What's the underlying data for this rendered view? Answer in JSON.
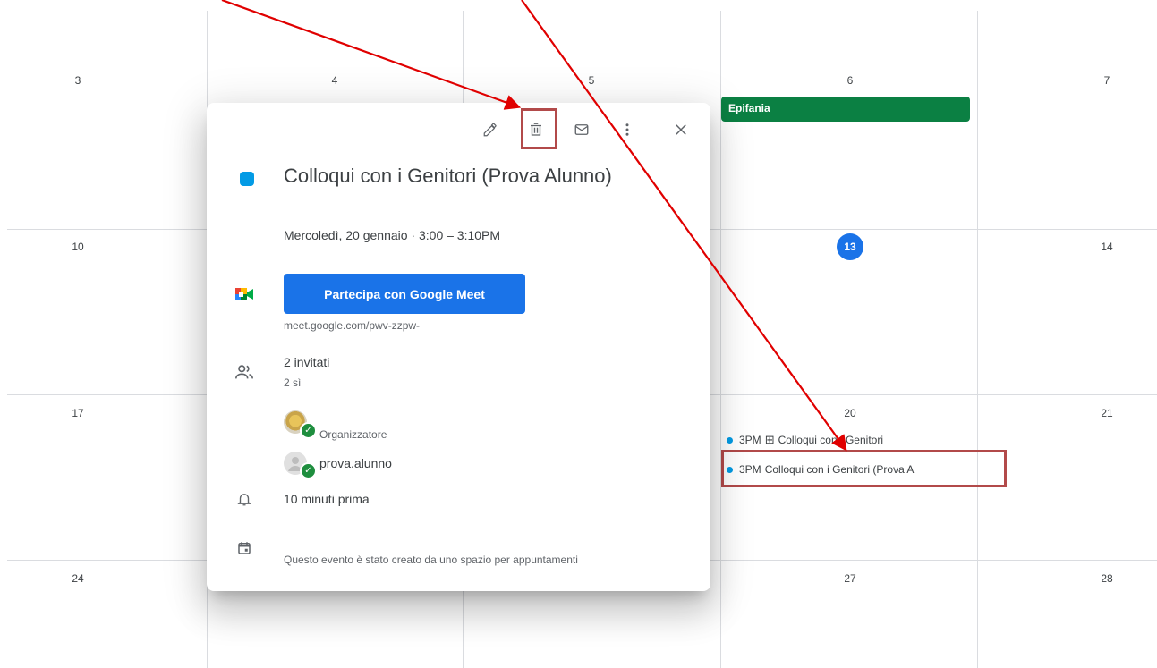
{
  "calendar": {
    "day_numbers": {
      "row1": [
        "3",
        "4",
        "5",
        "6",
        "7"
      ],
      "row2": [
        "10",
        "13",
        "14"
      ],
      "row3": [
        "17",
        "20",
        "21"
      ],
      "row4": [
        "24",
        "27",
        "28"
      ]
    },
    "holiday": "Epifania",
    "events": [
      {
        "time": "3PM",
        "title": "Colloqui con i Genitori"
      },
      {
        "time": "3PM",
        "title": "Colloqui con i Genitori (Prova A"
      }
    ],
    "colors": {
      "today": "#1a73e8",
      "holiday": "#0b8043",
      "event_dot": "#039be5",
      "highlight": "#b24a4a",
      "arrow": "#e00000"
    }
  },
  "popup": {
    "toolbar_icons": [
      "edit-icon",
      "delete-icon",
      "email-icon",
      "more-options-icon",
      "close-icon"
    ],
    "title": "Colloqui con i Genitori (Prova Alunno)",
    "datetime": "Mercoledì, 20 gennaio  ·  3:00 – 3:10PM",
    "meet_button": "Partecipa con Google Meet",
    "meet_link": "meet.google.com/pwv-zzpw-",
    "guests_count": "2 invitati",
    "guests_yes": "2 sì",
    "guests": [
      {
        "label": "Organizzatore"
      },
      {
        "label": "prova.alunno"
      }
    ],
    "reminder": "10 minuti prima",
    "note": "Questo evento è stato creato da uno spazio per appuntamenti"
  }
}
